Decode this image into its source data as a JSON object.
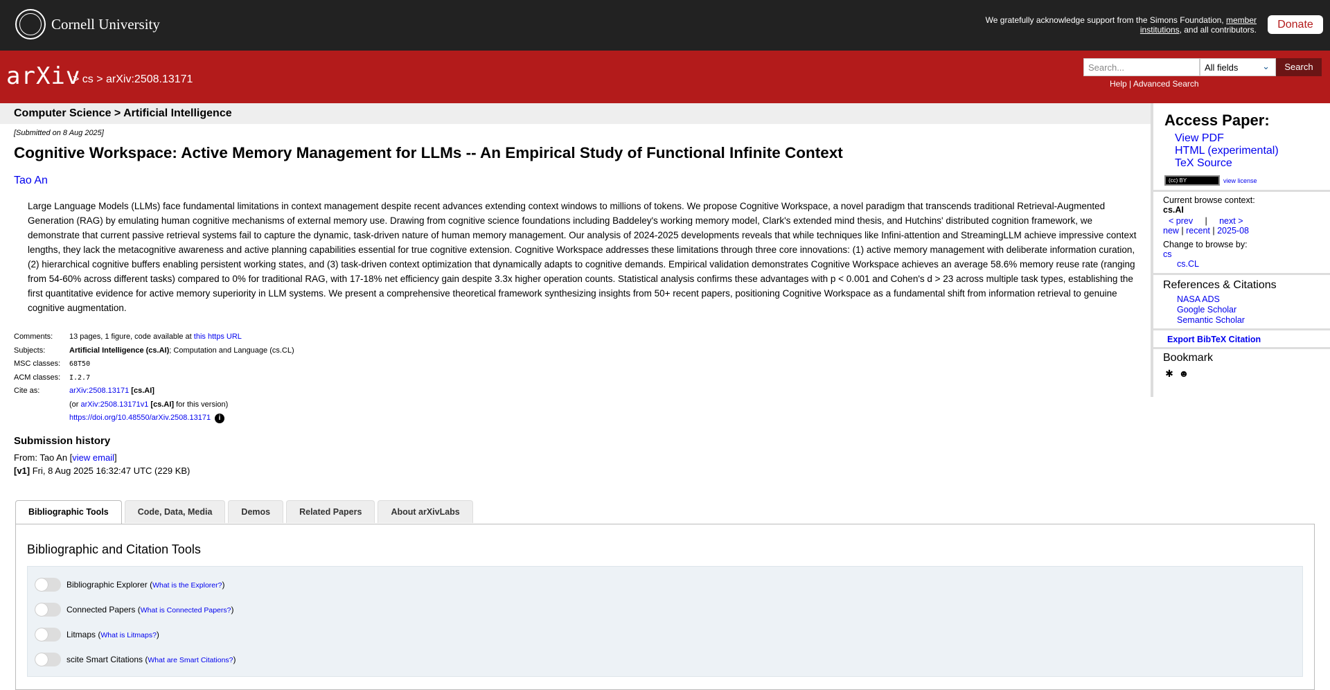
{
  "top": {
    "university": "Cornell University",
    "support_prefix": "We gratefully acknowledge support from the Simons Foundation,",
    "support_link": "member institutions",
    "support_suffix": ", and all contributors.",
    "donate": "Donate"
  },
  "header": {
    "logo": "arXiv",
    "breadcrumb": "> cs > arXiv:2508.13171",
    "search_placeholder": "Search...",
    "field_selected": "All fields",
    "search_button": "Search",
    "help": "Help",
    "separator": " | ",
    "advanced_search": "Advanced Search"
  },
  "subheader": "Computer Science > Artificial Intelligence",
  "paper": {
    "submitted": "[Submitted on 8 Aug 2025]",
    "title": "Cognitive Workspace: Active Memory Management for LLMs -- An Empirical Study of Functional Infinite Context",
    "author": "Tao An",
    "abstract": "Large Language Models (LLMs) face fundamental limitations in context management despite recent advances extending context windows to millions of tokens. We propose Cognitive Workspace, a novel paradigm that transcends traditional Retrieval-Augmented Generation (RAG) by emulating human cognitive mechanisms of external memory use. Drawing from cognitive science foundations including Baddeley's working memory model, Clark's extended mind thesis, and Hutchins' distributed cognition framework, we demonstrate that current passive retrieval systems fail to capture the dynamic, task-driven nature of human memory management. Our analysis of 2024-2025 developments reveals that while techniques like Infini-attention and StreamingLLM achieve impressive context lengths, they lack the metacognitive awareness and active planning capabilities essential for true cognitive extension. Cognitive Workspace addresses these limitations through three core innovations: (1) active memory management with deliberate information curation, (2) hierarchical cognitive buffers enabling persistent working states, and (3) task-driven context optimization that dynamically adapts to cognitive demands. Empirical validation demonstrates Cognitive Workspace achieves an average 58.6% memory reuse rate (ranging from 54-60% across different tasks) compared to 0% for traditional RAG, with 17-18% net efficiency gain despite 3.3x higher operation counts. Statistical analysis confirms these advantages with p < 0.001 and Cohen's d > 23 across multiple task types, establishing the first quantitative evidence for active memory superiority in LLM systems. We present a comprehensive theoretical framework synthesizing insights from 50+ recent papers, positioning Cognitive Workspace as a fundamental shift from information retrieval to genuine cognitive augmentation."
  },
  "meta": {
    "comments_label": "Comments:",
    "comments_text": "13 pages, 1 figure, code available at ",
    "comments_link": "this https URL",
    "subjects_label": "Subjects:",
    "subjects_primary": "Artificial Intelligence (cs.AI)",
    "subjects_rest": "; Computation and Language (cs.CL)",
    "msc_label": "MSC classes:",
    "msc_value": "68T50",
    "acm_label": "ACM classes:",
    "acm_value": "I.2.7",
    "cite_label": "Cite as:",
    "cite_id": "arXiv:2508.13171",
    "cite_cat": "[cs.AI]",
    "cite_or": "(or ",
    "cite_v_id": "arXiv:2508.13171v1",
    "cite_v_cat": "[cs.AI]",
    "cite_v_suffix": " for this version)",
    "doi": "https://doi.org/10.48550/arXiv.2508.13171"
  },
  "history": {
    "heading": "Submission history",
    "from": "From: Tao An [",
    "view_email": "view email",
    "from_end": "]",
    "version": "[v1]",
    "version_text": " Fri, 8 Aug 2025 16:32:47 UTC (229 KB)"
  },
  "tabs": [
    "Bibliographic Tools",
    "Code, Data, Media",
    "Demos",
    "Related Papers",
    "About arXivLabs"
  ],
  "tools": {
    "heading": "Bibliographic and Citation Tools",
    "items": [
      {
        "label": "Bibliographic Explorer",
        "link": "What is the Explorer?"
      },
      {
        "label": "Connected Papers",
        "link": "What is Connected Papers?"
      },
      {
        "label": "Litmaps",
        "link": "What is Litmaps?"
      },
      {
        "label": "scite Smart Citations",
        "link": "What are Smart Citations?"
      }
    ]
  },
  "sidebar": {
    "access_heading": "Access Paper:",
    "links": [
      "View PDF",
      "HTML (experimental)",
      "TeX Source"
    ],
    "license_badge": "(cc) BY",
    "view_license": "view license",
    "browse_context_label": "Current browse context:",
    "browse_context": "cs.AI",
    "prev": "< prev",
    "pipe": "|",
    "next": "next >",
    "new": "new",
    "recent": "recent",
    "month": "2025-08",
    "change_browse": "Change to browse by:",
    "browse_cs": "cs",
    "browse_cscl": "cs.CL",
    "refs_heading": "References & Citations",
    "refs": [
      "NASA ADS",
      "Google Scholar",
      "Semantic Scholar"
    ],
    "export_bibtex": "Export BibTeX Citation",
    "bookmark_heading": "Bookmark",
    "bookmark_icons": [
      "bibsonomy-icon",
      "reddit-icon"
    ]
  }
}
